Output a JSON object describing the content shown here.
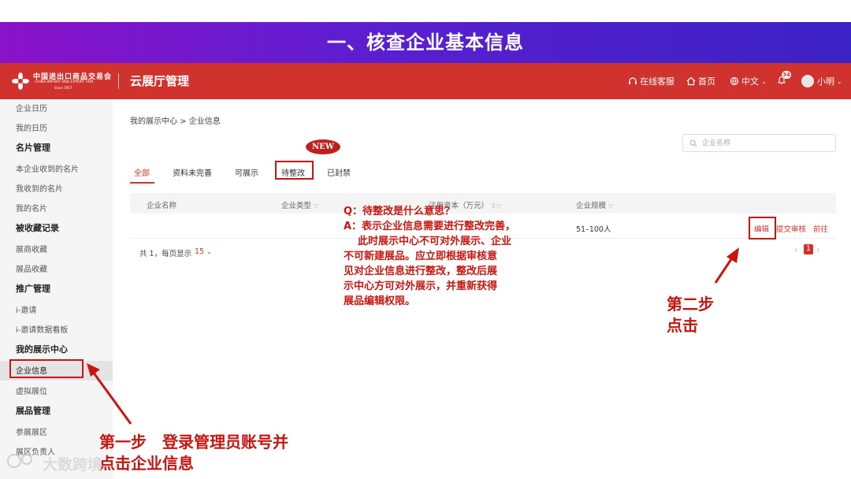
{
  "banner": {
    "title": "一、核查企业基本信息"
  },
  "topbar": {
    "logo_cn": "中国进出口商品交易会",
    "logo_en": "CHINA IMPORT AND EXPORT FAIR",
    "logo_since": "Since 1957",
    "app_title": "云展厅管理",
    "service": "在线客服",
    "home": "首页",
    "language": "中文",
    "notification_count": "34",
    "user": "小明"
  },
  "sidebar": {
    "items": [
      "企业日历",
      "我的日历",
      "名片管理",
      "本企业收到的名片",
      "我收到的名片",
      "我的名片",
      "被收藏记录",
      "展商收藏",
      "展品收藏",
      "推广管理",
      "i-邀请",
      "i-邀请数据看板",
      "我的展示中心",
      "企业信息",
      "虚拟展位",
      "展品管理",
      "参展展区",
      "展区负责人"
    ]
  },
  "main": {
    "breadcrumb": "我的展示中心 > 企业信息",
    "search_placeholder": "企业名称",
    "new_badge": "NEW",
    "tabs": [
      "全部",
      "资料未完善",
      "可展示",
      "待整改",
      "已封禁"
    ],
    "columns": [
      "企业名称",
      "企业类型",
      "注册资本（万元）",
      "企业规模"
    ],
    "row": {
      "scale": "51–100人",
      "actions": [
        "编辑",
        "提交审核",
        "前往"
      ]
    },
    "pager": {
      "total": "共 1，每页显示",
      "size": "15",
      "page": "1"
    }
  },
  "annotations": {
    "qa_lines": [
      "Q：待整改是什么意思？",
      "A：表示企业信息需要进行整改完善，",
      "此时展示中心不可对外展示、企业",
      "不可新建展品。应立即根据审核意",
      "见对企业信息进行整改，整改后展",
      "示中心方可对外展示，并重新获得",
      "展品编辑权限。"
    ],
    "step2_line1": "第二步",
    "step2_line2": "点击",
    "step1_line1": "第一步　登录管理员账号并",
    "step1_line2": "点击企业信息"
  },
  "watermark": "大数跨境",
  "colors": {
    "brand_red": "#d0322d",
    "annotation_red": "#c8150f",
    "banner_start": "#8a12c9",
    "banner_end": "#3b22c4"
  }
}
